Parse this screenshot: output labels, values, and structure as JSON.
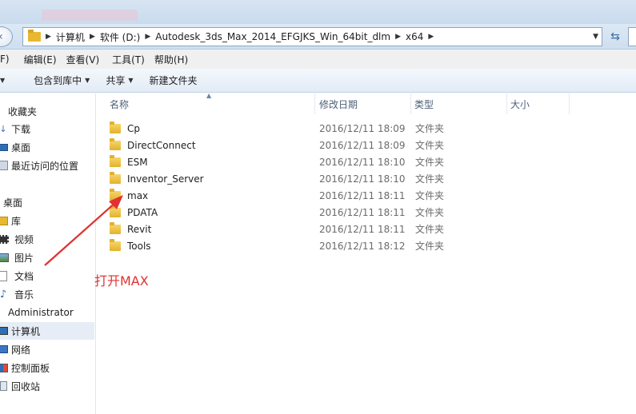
{
  "address": {
    "crumbs": [
      "计算机",
      "软件 (D:)",
      "Autodesk_3ds_Max_2014_EFGJKS_Win_64bit_dlm",
      "x64"
    ]
  },
  "menu": [
    "F)",
    "编辑(E)",
    "查看(V)",
    "工具(T)",
    "帮助(H)"
  ],
  "toolbar": {
    "include_label": "包含到库中",
    "share_label": "共享",
    "new_folder_label": "新建文件夹"
  },
  "sidebar": {
    "items": [
      {
        "label": "收藏夹",
        "icon": "star-icon"
      },
      {
        "label": "下载",
        "icon": "download-icon"
      },
      {
        "label": "桌面",
        "icon": "desktop-icon"
      },
      {
        "label": "最近访问的位置",
        "icon": "recent-places-icon"
      },
      {
        "label": "桌面",
        "icon": "desktop-icon"
      },
      {
        "label": "库",
        "icon": "library-icon"
      },
      {
        "label": "视频",
        "icon": "video-icon"
      },
      {
        "label": "图片",
        "icon": "picture-icon"
      },
      {
        "label": "文档",
        "icon": "document-icon"
      },
      {
        "label": "音乐",
        "icon": "music-icon"
      },
      {
        "label": "Administrator",
        "icon": "user-icon"
      },
      {
        "label": "计算机",
        "icon": "computer-icon"
      },
      {
        "label": "网络",
        "icon": "network-icon"
      },
      {
        "label": "控制面板",
        "icon": "control-panel-icon"
      },
      {
        "label": "回收站",
        "icon": "recycle-bin-icon"
      }
    ]
  },
  "columns": {
    "name": "名称",
    "date": "修改日期",
    "type": "类型",
    "size": "大小"
  },
  "files": [
    {
      "name": "Cp",
      "date": "2016/12/11 18:09",
      "type": "文件夹"
    },
    {
      "name": "DirectConnect",
      "date": "2016/12/11 18:09",
      "type": "文件夹"
    },
    {
      "name": "ESM",
      "date": "2016/12/11 18:10",
      "type": "文件夹"
    },
    {
      "name": "Inventor_Server",
      "date": "2016/12/11 18:10",
      "type": "文件夹"
    },
    {
      "name": "max",
      "date": "2016/12/11 18:11",
      "type": "文件夹"
    },
    {
      "name": "PDATA",
      "date": "2016/12/11 18:11",
      "type": "文件夹"
    },
    {
      "name": "Revit",
      "date": "2016/12/11 18:11",
      "type": "文件夹"
    },
    {
      "name": "Tools",
      "date": "2016/12/11 18:12",
      "type": "文件夹"
    }
  ],
  "annotation": "打开MAX",
  "colors": {
    "annotation": "#e03232",
    "folder": "#e3b12c",
    "selection": "#e6edf6"
  }
}
